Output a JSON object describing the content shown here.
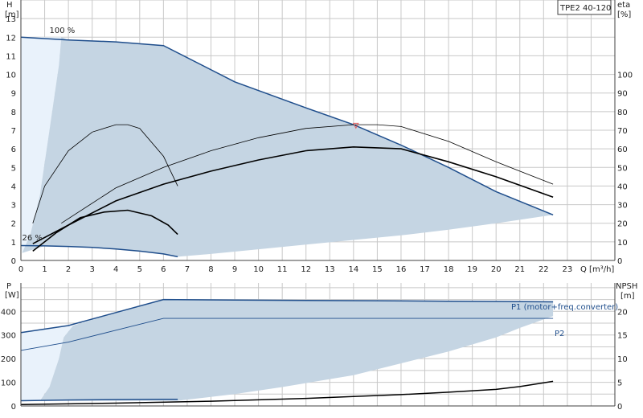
{
  "title_box": "TPE2 40-120",
  "colors": {
    "grid": "#c8c8c8",
    "axis": "#404040",
    "area": "#c5d5e3",
    "area_light": "#e9f2fb",
    "blue_line": "#1f4e8c",
    "black_line": "#000000",
    "marker": "#e06060"
  },
  "chart_data": [
    {
      "type": "line",
      "name": "head-and-efficiency",
      "xlabel": "Q [m³/h]",
      "ylabel_left": "H\n[m]",
      "ylabel_right": "eta\n[%]",
      "xlim": [
        0,
        25
      ],
      "ylim_left": [
        0,
        14
      ],
      "ylim_right": [
        0,
        140
      ],
      "x_ticks": [
        0,
        1,
        2,
        3,
        4,
        5,
        6,
        7,
        8,
        9,
        10,
        11,
        12,
        13,
        14,
        15,
        16,
        17,
        18,
        19,
        20,
        21,
        22,
        23
      ],
      "y_ticks_left": [
        0,
        1,
        2,
        3,
        4,
        5,
        6,
        7,
        8,
        9,
        10,
        11,
        12,
        13
      ],
      "y_ticks_right": [
        0,
        10,
        20,
        30,
        40,
        50,
        60,
        70,
        80,
        90,
        100
      ],
      "annotations": [
        {
          "text": "100 %",
          "x": 1.2,
          "y": 12.15
        },
        {
          "text": "26 %",
          "x": 0.05,
          "y": 1.0
        }
      ],
      "series": [
        {
          "role": "head-max",
          "x": [
            0,
            2,
            4,
            6,
            9,
            12,
            14,
            16,
            18,
            20,
            22.4
          ],
          "y": [
            12.0,
            11.85,
            11.75,
            11.55,
            9.6,
            8.2,
            7.3,
            6.2,
            5.0,
            3.7,
            2.45
          ]
        },
        {
          "role": "head-min",
          "x": [
            0,
            1,
            2,
            3,
            4,
            5,
            6,
            6.6
          ],
          "y": [
            0.8,
            0.78,
            0.75,
            0.7,
            0.62,
            0.5,
            0.35,
            0.2
          ]
        },
        {
          "role": "area-lower",
          "x": [
            6.6,
            8,
            10,
            12,
            14,
            16,
            18,
            20,
            22.4
          ],
          "y": [
            0.2,
            0.35,
            0.6,
            0.85,
            1.1,
            1.35,
            1.65,
            2.0,
            2.45
          ]
        },
        {
          "role": "head-light-left",
          "x": [
            0.05,
            0.4,
            0.8,
            1.2,
            1.6,
            1.7
          ],
          "y": [
            0.4,
            1.4,
            3.5,
            7.0,
            10.5,
            12.0
          ]
        },
        {
          "role": "eta-max",
          "x": [
            1.7,
            4,
            6,
            8,
            10,
            12,
            14,
            15,
            16,
            18,
            20,
            22.4
          ],
          "y": [
            2.0,
            3.9,
            5.0,
            5.9,
            6.6,
            7.1,
            7.3,
            7.3,
            7.2,
            6.4,
            5.3,
            4.1
          ]
        },
        {
          "role": "eta-min",
          "x": [
            0.5,
            1,
            2,
            3,
            4,
            4.5,
            5,
            6,
            6.6
          ],
          "y": [
            2.0,
            4.0,
            5.9,
            6.9,
            7.3,
            7.3,
            7.1,
            5.6,
            4.0
          ]
        },
        {
          "role": "eta-motor-max",
          "x": [
            0.5,
            2,
            4,
            6,
            8,
            10,
            12,
            14,
            16,
            18,
            20,
            22.4
          ],
          "y": [
            0.9,
            1.9,
            3.2,
            4.1,
            4.8,
            5.4,
            5.9,
            6.1,
            6.0,
            5.3,
            4.5,
            3.4
          ]
        },
        {
          "role": "eta-motor-min",
          "x": [
            0.5,
            1.5,
            2.5,
            3.5,
            4.5,
            5.5,
            6.2,
            6.6
          ],
          "y": [
            0.5,
            1.5,
            2.3,
            2.6,
            2.7,
            2.4,
            1.9,
            1.4
          ]
        }
      ],
      "marker_point": {
        "x": 14.1,
        "y": 7.2
      }
    },
    {
      "type": "line",
      "name": "power-and-npsh",
      "ylabel_left": "P\n[W]",
      "ylabel_right": "NPSH\n[m]",
      "xlim": [
        0,
        25
      ],
      "ylim_left": [
        0,
        520
      ],
      "ylim_right": [
        0,
        26
      ],
      "y_ticks_left": [
        0,
        100,
        200,
        300,
        400
      ],
      "y_ticks_right": [
        0,
        5,
        10,
        15,
        20
      ],
      "series": [
        {
          "name": "P1 (motor+freq.converter)",
          "x": [
            0,
            2,
            4,
            6,
            9,
            12,
            15,
            18,
            22.4
          ],
          "y": [
            310,
            340,
            395,
            450,
            448,
            446,
            445,
            443,
            440
          ]
        },
        {
          "name": "P2",
          "x": [
            0,
            2,
            4,
            6,
            9,
            12,
            15,
            18,
            22.4
          ],
          "y": [
            235,
            270,
            320,
            370,
            370,
            370,
            370,
            370,
            370
          ]
        },
        {
          "role": "p1-min",
          "x": [
            0,
            2,
            4,
            6,
            6.6
          ],
          "y": [
            22,
            25,
            27,
            28,
            28
          ]
        },
        {
          "role": "npsh",
          "x": [
            0,
            4,
            8,
            12,
            14,
            16,
            18,
            20,
            21,
            22.4
          ],
          "y": [
            0.3,
            0.6,
            1.0,
            1.6,
            2.0,
            2.4,
            2.9,
            3.5,
            4.1,
            5.2
          ]
        }
      ],
      "area_upper": {
        "x": [
          0,
          2,
          4,
          6,
          9,
          12,
          15,
          18,
          22.4
        ],
        "y": [
          310,
          340,
          395,
          450,
          448,
          446,
          445,
          443,
          440
        ]
      },
      "area_lower": {
        "x": [
          6.6,
          9,
          11,
          14,
          16,
          18,
          20,
          21,
          22.4
        ],
        "y": [
          22,
          50,
          80,
          130,
          180,
          230,
          290,
          330,
          380
        ]
      },
      "area_light_left": {
        "x": [
          0,
          0.8,
          1.2,
          1.6,
          1.8,
          2.2
        ],
        "y": [
          20,
          25,
          80,
          200,
          290,
          340
        ]
      }
    }
  ]
}
